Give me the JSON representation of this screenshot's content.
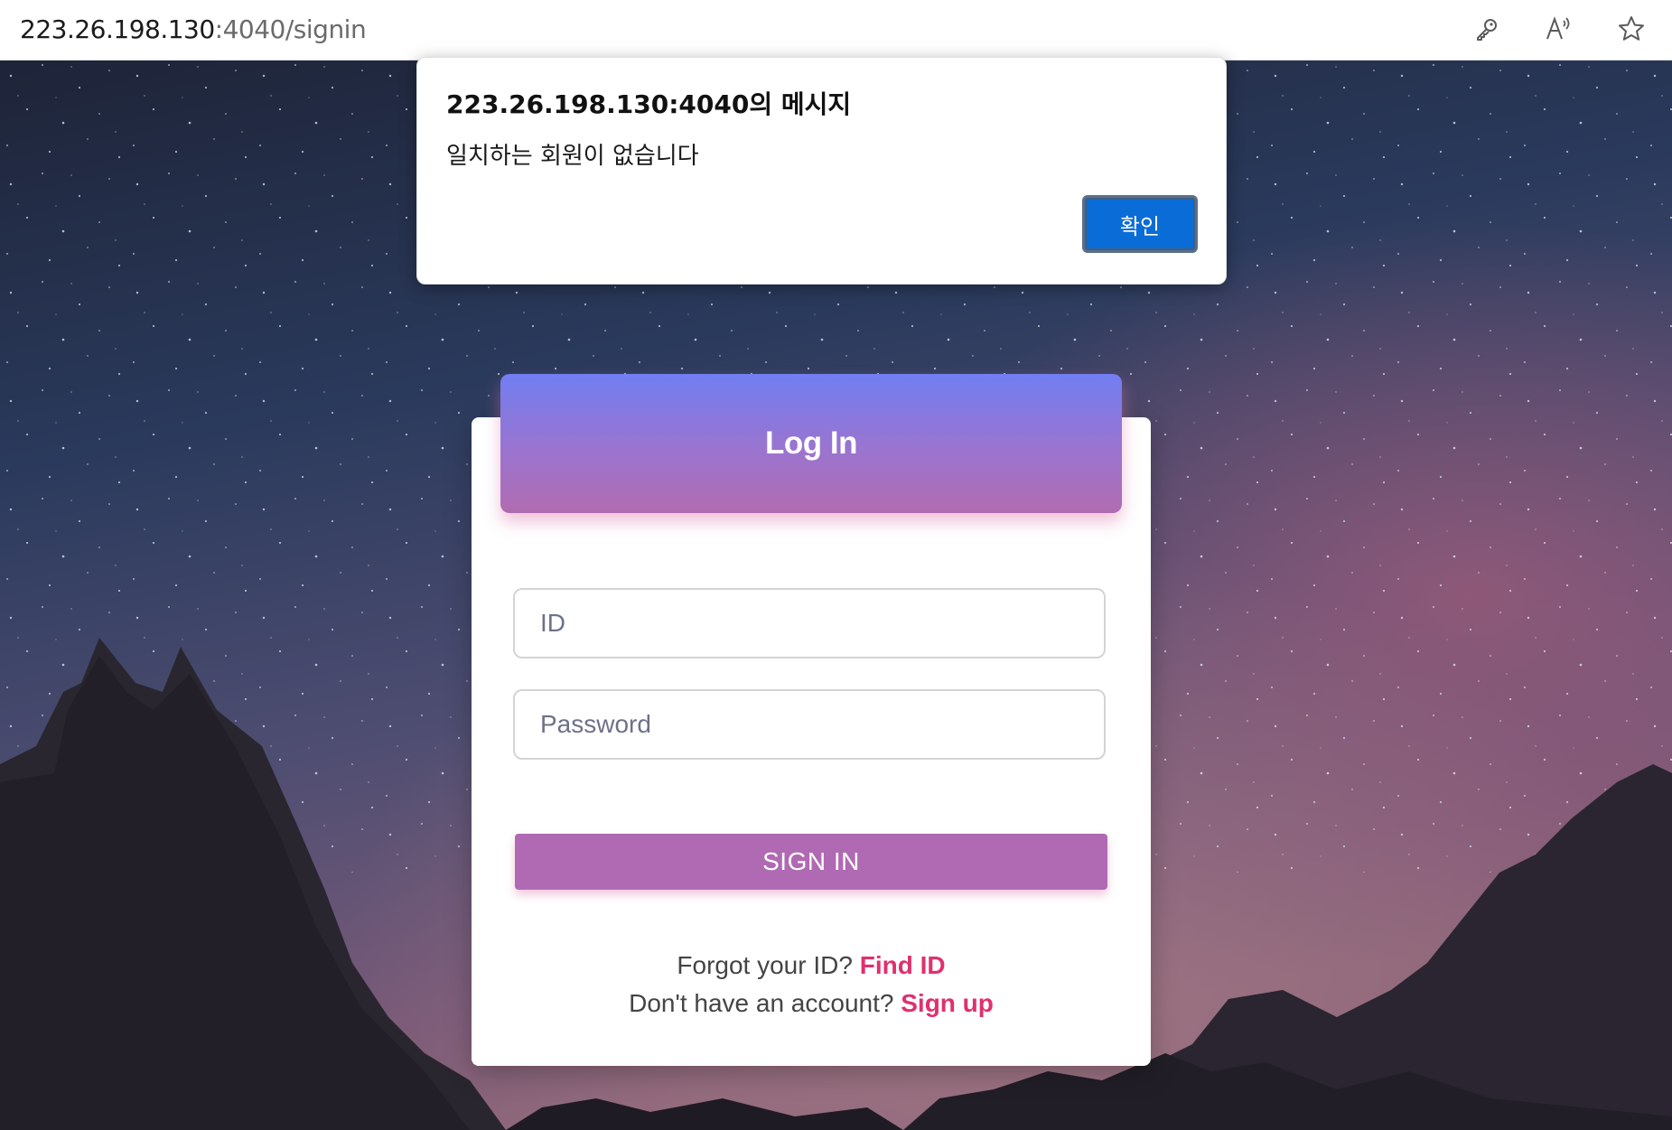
{
  "browser": {
    "url_host": "223.26.198.130",
    "url_rest": ":4040/signin",
    "icons": [
      "key-icon",
      "read-aloud-icon",
      "favorite-star-icon"
    ]
  },
  "alert": {
    "title": "223.26.198.130:4040의 메시지",
    "message": "일치하는 회원이 없습니다",
    "ok_label": "확인"
  },
  "login": {
    "title": "Log In",
    "id_placeholder": "ID",
    "password_placeholder": "Password",
    "submit_label": "SIGN IN",
    "forgot_text": "Forgot your ID?",
    "find_id_link": "Find ID",
    "no_account_text": "Don't have an account?",
    "signup_link": "Sign up"
  },
  "colors": {
    "header_gradient_top": "#717ef2",
    "header_gradient_bottom": "#b16cb0",
    "button": "#b06ab3",
    "link": "#e0306e",
    "dialog_button": "#0a6cd6"
  }
}
